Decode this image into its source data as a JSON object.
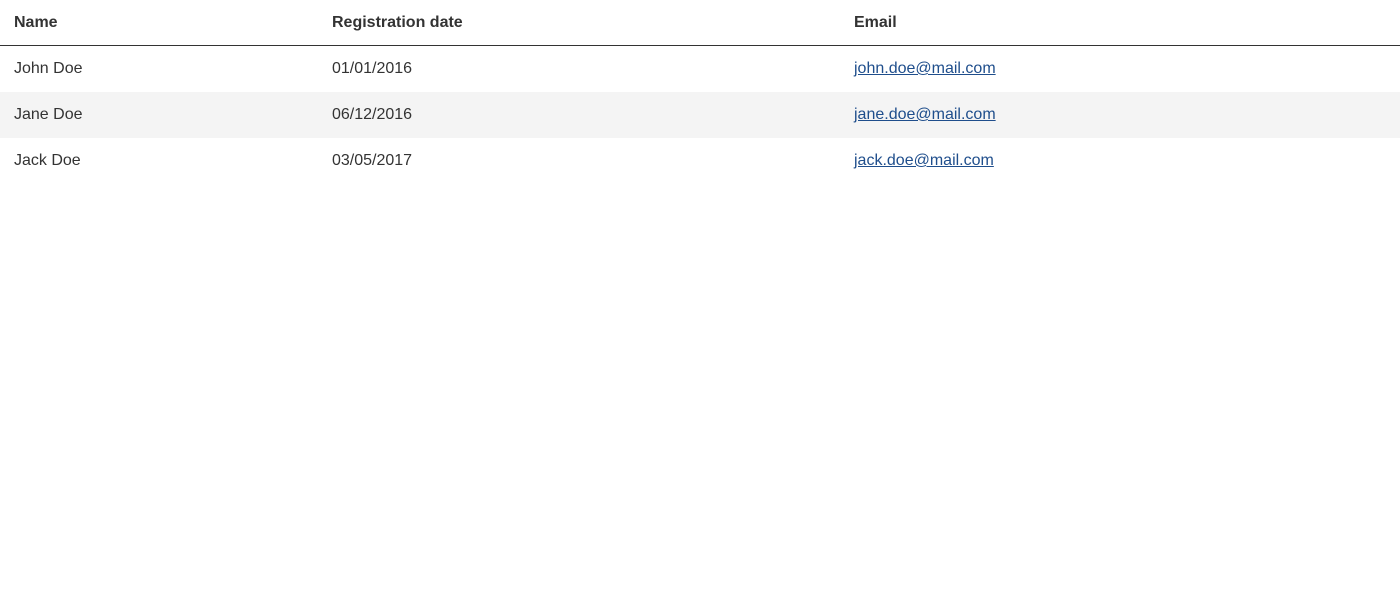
{
  "table": {
    "headers": {
      "name": "Name",
      "registration_date": "Registration date",
      "email": "Email"
    },
    "rows": [
      {
        "name": "John Doe",
        "registration_date": "01/01/2016",
        "email": "john.doe@mail.com"
      },
      {
        "name": "Jane Doe",
        "registration_date": "06/12/2016",
        "email": "jane.doe@mail.com"
      },
      {
        "name": "Jack Doe",
        "registration_date": "03/05/2017",
        "email": "jack.doe@mail.com"
      }
    ]
  },
  "colors": {
    "text": "#333333",
    "link": "#1f4e8c",
    "stripe_row": "#f4f4f4",
    "header_border": "#333333"
  }
}
